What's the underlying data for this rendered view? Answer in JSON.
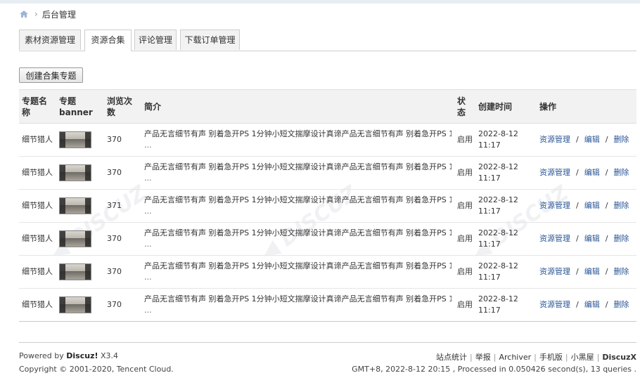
{
  "breadcrumb": {
    "current": "后台管理"
  },
  "tabs": [
    {
      "label": "素材资源管理",
      "active": false
    },
    {
      "label": "资源合集",
      "active": true
    },
    {
      "label": "评论管理",
      "active": false
    },
    {
      "label": "下载订单管理",
      "active": false
    }
  ],
  "create_button": "创建合集专题",
  "table": {
    "headers": {
      "name": "专题名称",
      "banner": "专题banner",
      "views": "浏览次数",
      "intro": "简介",
      "status": "状态",
      "created": "创建时间",
      "ops": "操作"
    },
    "rows": [
      {
        "name": "细节猎人",
        "views": "370",
        "intro": "产品无言细节有声 别着急开PS 1分钟小短文揣摩设计真谛产品无言细节有声 别着急开PS 1",
        "ellipsis": "...",
        "status": "启用",
        "date": "2022-8-12",
        "time": "11:17",
        "op_manage": "资源管理",
        "op_edit": "编辑",
        "op_delete": "删除"
      },
      {
        "name": "细节猎人",
        "views": "370",
        "intro": "产品无言细节有声 别着急开PS 1分钟小短文揣摩设计真谛产品无言细节有声 别着急开PS 1",
        "ellipsis": "...",
        "status": "启用",
        "date": "2022-8-12",
        "time": "11:17",
        "op_manage": "资源管理",
        "op_edit": "编辑",
        "op_delete": "删除"
      },
      {
        "name": "细节猎人",
        "views": "371",
        "intro": "产品无言细节有声 别着急开PS 1分钟小短文揣摩设计真谛产品无言细节有声 别着急开PS 1",
        "ellipsis": "...",
        "status": "启用",
        "date": "2022-8-12",
        "time": "11:17",
        "op_manage": "资源管理",
        "op_edit": "编辑",
        "op_delete": "删除"
      },
      {
        "name": "细节猎人",
        "views": "370",
        "intro": "产品无言细节有声 别着急开PS 1分钟小短文揣摩设计真谛产品无言细节有声 别着急开PS 1",
        "ellipsis": "...",
        "status": "启用",
        "date": "2022-8-12",
        "time": "11:17",
        "op_manage": "资源管理",
        "op_edit": "编辑",
        "op_delete": "删除"
      },
      {
        "name": "细节猎人",
        "views": "370",
        "intro": "产品无言细节有声 别着急开PS 1分钟小短文揣摩设计真谛产品无言细节有声 别着急开PS 1",
        "ellipsis": "...",
        "status": "启用",
        "date": "2022-8-12",
        "time": "11:17",
        "op_manage": "资源管理",
        "op_edit": "编辑",
        "op_delete": "删除"
      },
      {
        "name": "细节猎人",
        "views": "370",
        "intro": "产品无言细节有声 别着急开PS 1分钟小短文揣摩设计真谛产品无言细节有声 别着急开PS 1",
        "ellipsis": "...",
        "status": "启用",
        "date": "2022-8-12",
        "time": "11:17",
        "op_manage": "资源管理",
        "op_edit": "编辑",
        "op_delete": "删除"
      }
    ]
  },
  "footer": {
    "powered_prefix": "Powered by",
    "powered_brand": "Discuz!",
    "powered_version": "X3.4",
    "copyright": "Copyright © 2001-2020, Tencent Cloud.",
    "links": [
      "站点统计",
      "举报",
      "Archiver",
      "手机版",
      "小黑屋",
      "DiscuzX"
    ],
    "stats": "GMT+8, 2022-8-12 20:15 , Processed in 0.050426 second(s), 13 queries ."
  },
  "colors": {
    "link": "#2a5596",
    "header_bg": "#f2f2f2",
    "border": "#cdcdcd"
  }
}
